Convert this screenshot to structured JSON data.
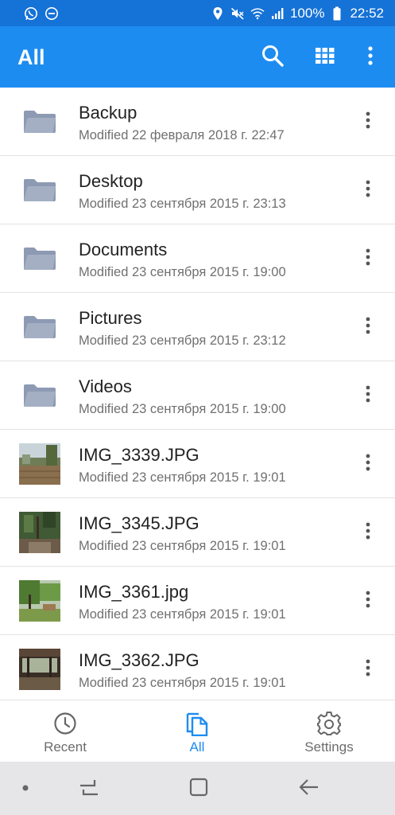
{
  "status_bar": {
    "icons_left": [
      "whatsapp-icon",
      "do-not-disturb-icon"
    ],
    "icons_right": [
      "location-icon",
      "mute-icon",
      "wifi-icon",
      "signal-icon",
      "battery-icon"
    ],
    "battery": "100%",
    "time": "22:52"
  },
  "app_bar": {
    "title": "All",
    "actions": [
      "search-icon",
      "grid-view-icon",
      "more-vert-icon"
    ]
  },
  "files": [
    {
      "name": "Backup",
      "modified": "Modified 22 февраля 2018 г. 22:47",
      "type": "folder"
    },
    {
      "name": "Desktop",
      "modified": "Modified 23 сентября 2015 г. 23:13",
      "type": "folder"
    },
    {
      "name": "Documents",
      "modified": "Modified 23 сентября 2015 г. 19:00",
      "type": "folder"
    },
    {
      "name": "Pictures",
      "modified": "Modified 23 сентября 2015 г. 23:12",
      "type": "folder"
    },
    {
      "name": "Videos",
      "modified": "Modified 23 сентября 2015 г. 19:00",
      "type": "folder"
    },
    {
      "name": "IMG_3339.JPG",
      "modified": "Modified 23 сентября 2015 г. 19:01",
      "type": "image"
    },
    {
      "name": "IMG_3345.JPG",
      "modified": "Modified 23 сентября 2015 г. 19:01",
      "type": "image"
    },
    {
      "name": "IMG_3361.jpg",
      "modified": "Modified 23 сентября 2015 г. 19:01",
      "type": "image"
    },
    {
      "name": "IMG_3362.JPG",
      "modified": "Modified 23 сентября 2015 г. 19:01",
      "type": "image"
    }
  ],
  "bottom_nav": {
    "recent": "Recent",
    "all": "All",
    "settings": "Settings",
    "active": "all"
  },
  "colors": {
    "status_bar": "#1572d6",
    "app_bar": "#1d8cf1",
    "accent": "#1d8cf1",
    "folder_icon": "#8d9ab3"
  }
}
